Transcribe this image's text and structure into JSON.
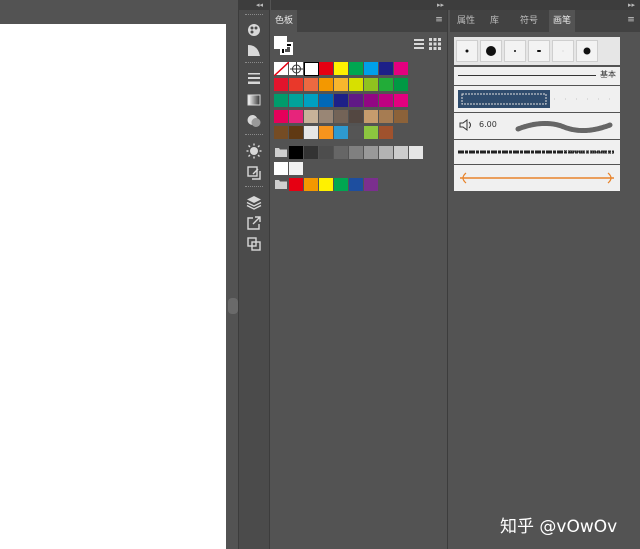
{
  "swatches_panel": {
    "tab_label": "色板"
  },
  "right_panel": {
    "tabs": [
      "属性",
      "库",
      "符号",
      "画笔"
    ],
    "active_tab": "画笔"
  },
  "brushes": {
    "basic_label": "基本",
    "size_value": "6.00"
  },
  "watermark": "知乎 @vOwOv",
  "collapse_glyph": "◂◂",
  "expand_glyph": "▸▸",
  "colors": {
    "row1": [
      "#ffffff",
      "#ffffff",
      "#000000",
      "#e60012",
      "#fff100",
      "#00a651",
      "#00a0e9",
      "#1d2088",
      "#e4007f"
    ],
    "row2": [
      "#e2142c",
      "#e9382a",
      "#ec6941",
      "#f39800",
      "#f8b62d",
      "#d7e000",
      "#8fc31f",
      "#22ac38",
      "#009944"
    ],
    "row3": [
      "#009b6b",
      "#00a29a",
      "#00a0c1",
      "#0068b7",
      "#1d2088",
      "#601986",
      "#920783",
      "#be0081",
      "#e4007f"
    ],
    "row4": [
      "#e5005a",
      "#e7247b",
      "#c7b299",
      "#998675",
      "#736357",
      "#534741",
      "#c69c6d",
      "#a67c52",
      "#8c6239"
    ],
    "row5": [
      "#754c24",
      "#603913",
      "#e6e6e6",
      "#f7941d",
      "#2e9ad0",
      "#555555",
      "#8cc63f",
      "#a0522d"
    ],
    "row6": [
      "#000000",
      "#333333",
      "#4d4d4d",
      "#666666",
      "#808080",
      "#999999",
      "#b3b3b3",
      "#cccccc",
      "#e6e6e6"
    ],
    "row7": [
      "#ffffff",
      "#f2f2f2"
    ],
    "row8": [
      "#e60012",
      "#f39800",
      "#fff100",
      "#00a651",
      "#1d4e9f",
      "#7b2f8e"
    ]
  }
}
